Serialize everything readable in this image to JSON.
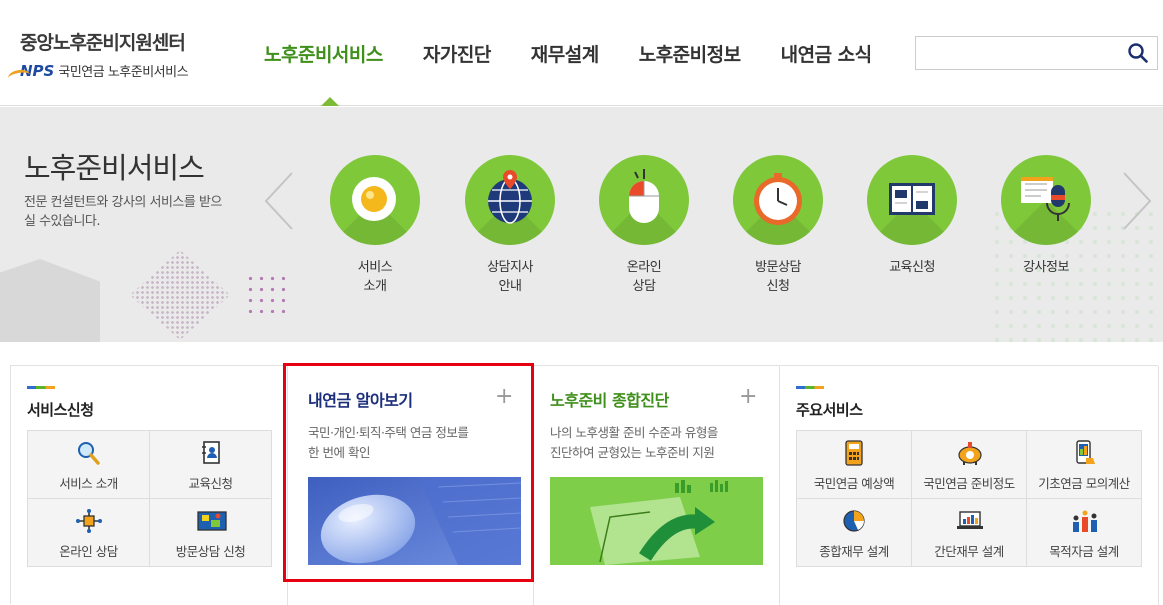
{
  "header": {
    "logo_title": "중앙노후준비지원센터",
    "logo_nps": "NPS",
    "logo_sub": "국민연금 노후준비서비스",
    "nav": [
      {
        "label": "노후준비서비스",
        "active": true
      },
      {
        "label": "자가진단"
      },
      {
        "label": "재무설계"
      },
      {
        "label": "노후준비정보"
      },
      {
        "label": "내연금 소식"
      }
    ],
    "search_placeholder": "",
    "accent_color": "#3f8f1b"
  },
  "banner": {
    "title": "노후준비서비스",
    "description": "전문 컨설턴트와 강사의 서비스를 받으실 수있습니다.",
    "services": [
      {
        "label": "서비스\n소개",
        "icon": "egg-plate-icon"
      },
      {
        "label": "상담지사\n안내",
        "icon": "globe-pin-icon"
      },
      {
        "label": "온라인\n상담",
        "icon": "mouse-icon"
      },
      {
        "label": "방문상담\n신청",
        "icon": "clock-icon"
      },
      {
        "label": "교육신청",
        "icon": "book-icon"
      },
      {
        "label": "강사정보",
        "icon": "microphone-icon"
      }
    ]
  },
  "panels": {
    "service_apply": {
      "title": "서비스신청",
      "items": [
        {
          "label": "서비스 소개",
          "icon": "magnifier-icon"
        },
        {
          "label": "교육신청",
          "icon": "contact-book-icon"
        },
        {
          "label": "온라인 상담",
          "icon": "network-icon"
        },
        {
          "label": "방문상담 신청",
          "icon": "map-icon"
        }
      ]
    },
    "my_pension": {
      "title": "내연금 알아보기",
      "description": "국민·개인·퇴직·주택 연금 정보를\n한 번에 확인",
      "plus": "+"
    },
    "retirement_diag": {
      "title": "노후준비 종합진단",
      "description": "나의 노후생활 준비 수준과 유형을\n진단하여 균형있는 노후준비 지원",
      "plus": "+"
    },
    "main_services": {
      "title": "주요서비스",
      "items": [
        {
          "label": "국민연금 예상액",
          "icon": "calculator-icon"
        },
        {
          "label": "국민연금 준비정도",
          "icon": "piggy-bank-icon"
        },
        {
          "label": "기초연금 모의계산",
          "icon": "phone-hand-icon"
        },
        {
          "label": "종합재무 설계",
          "icon": "pie-chart-icon"
        },
        {
          "label": "간단재무 설계",
          "icon": "laptop-chart-icon"
        },
        {
          "label": "목적자금 설계",
          "icon": "bar-figures-icon"
        }
      ]
    }
  }
}
